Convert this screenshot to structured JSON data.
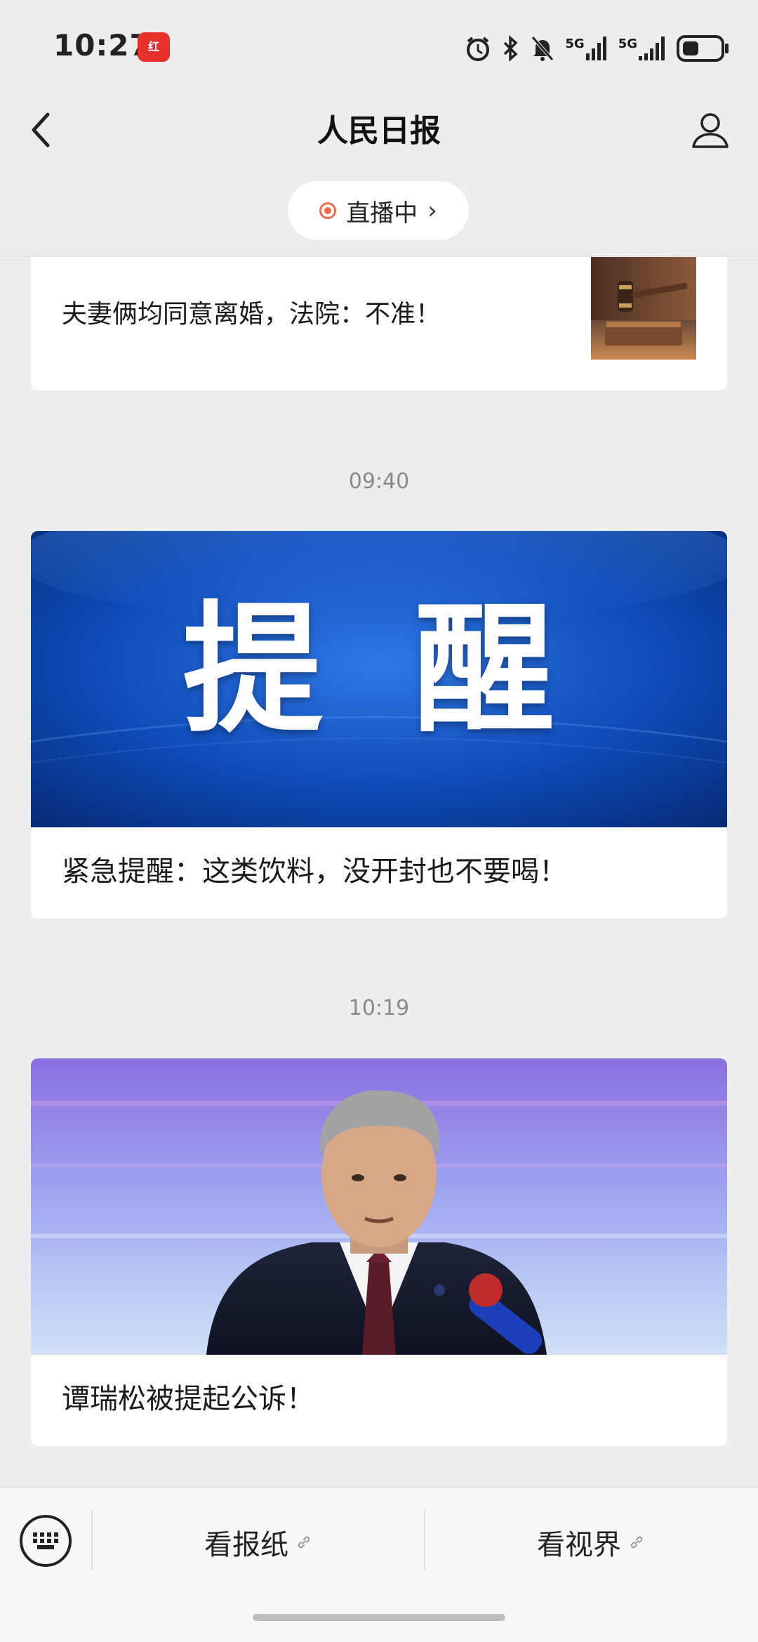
{
  "status_bar": {
    "time": "10:27",
    "app_badge": "红",
    "network_1": "5G",
    "network_2": "5G"
  },
  "header": {
    "title": "人民日报",
    "live_label": "直播中",
    "live_chevron": "›"
  },
  "feed": [
    {
      "time": "",
      "headline": "夫妻俩均同意离婚，法院：不准！",
      "thumbnail": "gavel-photo"
    },
    {
      "time": "09:40",
      "headline": "紧急提醒：这类饮料，没开封也不要喝！",
      "banner_text": "提 醒"
    },
    {
      "time": "10:19",
      "headline": "谭瑞松被提起公诉！",
      "banner": "press-conference-photo"
    }
  ],
  "bottom_menu": {
    "item_1": "看报纸",
    "item_2": "看视界"
  },
  "colors": {
    "live_accent": "#f06a4f",
    "banner_blue": "#0b3a9a",
    "badge_red": "#e8312d"
  }
}
